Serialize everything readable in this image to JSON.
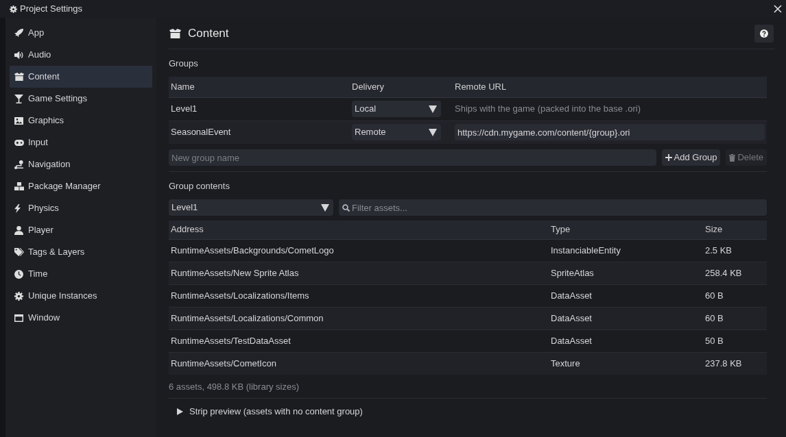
{
  "window": {
    "title": "Project Settings"
  },
  "sidebar": {
    "items": [
      {
        "label": "App",
        "selected": false
      },
      {
        "label": "Audio",
        "selected": false
      },
      {
        "label": "Content",
        "selected": true
      },
      {
        "label": "Game Settings",
        "selected": false
      },
      {
        "label": "Graphics",
        "selected": false
      },
      {
        "label": "Input",
        "selected": false
      },
      {
        "label": "Navigation",
        "selected": false
      },
      {
        "label": "Package Manager",
        "selected": false
      },
      {
        "label": "Physics",
        "selected": false
      },
      {
        "label": "Player",
        "selected": false
      },
      {
        "label": "Tags & Layers",
        "selected": false
      },
      {
        "label": "Time",
        "selected": false
      },
      {
        "label": "Unique Instances",
        "selected": false
      },
      {
        "label": "Window",
        "selected": false
      }
    ]
  },
  "content": {
    "title": "Content",
    "groups": {
      "label": "Groups",
      "columns": [
        "Name",
        "Delivery",
        "Remote URL"
      ],
      "rows": [
        {
          "name": "Level1",
          "delivery": "Local",
          "remote_url": {
            "kind": "note",
            "text": "Ships with the game (packed into the base .ori)"
          }
        },
        {
          "name": "SeasonalEvent",
          "delivery": "Remote",
          "remote_url": {
            "kind": "field",
            "value": "https://cdn.mygame.com/content/{group}.ori"
          }
        }
      ],
      "new_group": {
        "placeholder": "New group name"
      },
      "buttons": [
        {
          "label": "Add Group",
          "disabled": false
        },
        {
          "label": "Delete",
          "disabled": true
        }
      ]
    },
    "group_contents": {
      "label": "Group contents",
      "group_select": "Level1",
      "filter": {
        "placeholder": "Filter assets..."
      },
      "columns": [
        "Address",
        "Type",
        "Size"
      ],
      "rows": [
        [
          "RuntimeAssets/Backgrounds/CometLogo",
          "InstanciableEntity",
          "2.5 KB"
        ],
        [
          "RuntimeAssets/New Sprite Atlas",
          "SpriteAtlas",
          "258.4 KB"
        ],
        [
          "RuntimeAssets/Localizations/Items",
          "DataAsset",
          "60 B"
        ],
        [
          "RuntimeAssets/Localizations/Common",
          "DataAsset",
          "60 B"
        ],
        [
          "RuntimeAssets/TestDataAsset",
          "DataAsset",
          "50 B"
        ],
        [
          "RuntimeAssets/CometIcon",
          "Texture",
          "237.8 KB"
        ]
      ],
      "summary": "6 assets, 498.8 KB (library sizes)"
    },
    "strip_preview": {
      "label": "Strip preview (assets with no content group)",
      "expanded": false
    }
  }
}
